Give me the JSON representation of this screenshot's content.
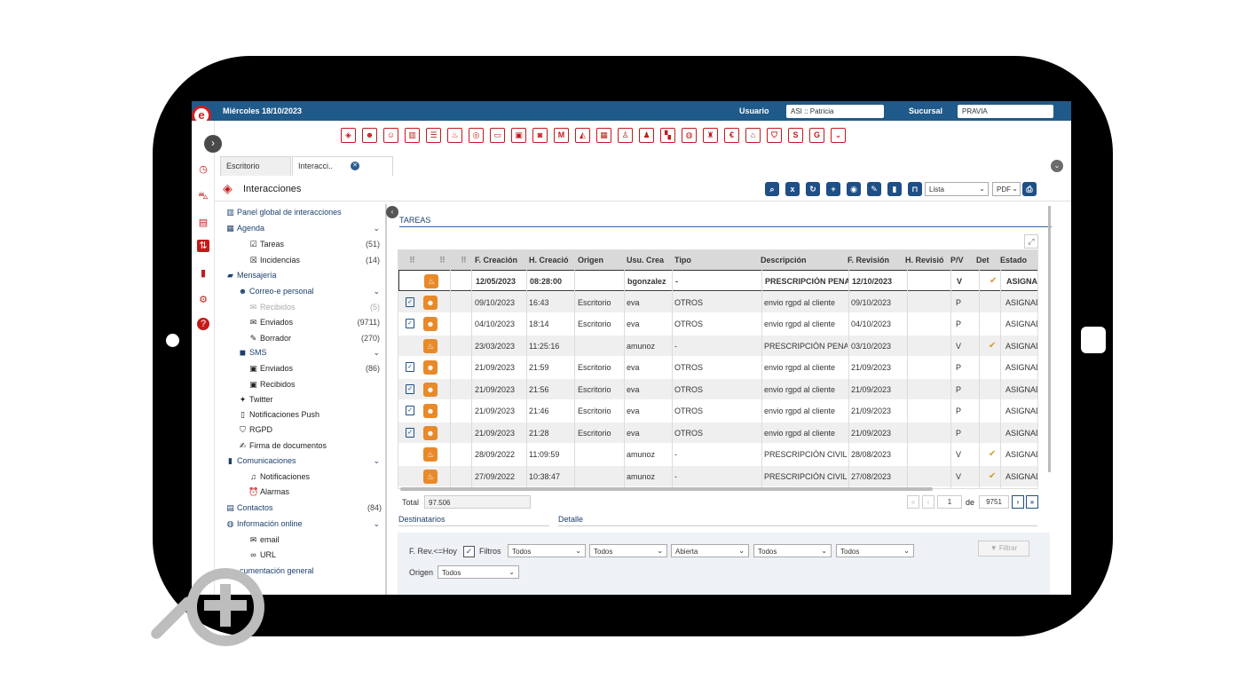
{
  "topbar": {
    "date": "Miércoles 18/10/2023",
    "user_label": "Usuario",
    "user_value": "ASI :: Patricia",
    "branch_label": "Sucursal",
    "branch_value": "PRAVIA"
  },
  "tabs": [
    {
      "label": "Escritorio"
    },
    {
      "label": "Interacci.."
    }
  ],
  "header": {
    "title": "Interacciones",
    "view_select": "Lista",
    "export_select": "PDF"
  },
  "nav": {
    "panel_global": "Panel global de interacciones",
    "agenda": "Agenda",
    "tareas": "Tareas",
    "tareas_count": "(51)",
    "incidencias": "Incidencias",
    "incidencias_count": "(14)",
    "mensajeria": "Mensajería",
    "correo": "Correo-e personal",
    "recibidos": "Recibidos",
    "recibidos_count": "(5)",
    "enviados": "Enviados",
    "enviados_count": "(9711)",
    "borrador": "Borrador",
    "borrador_count": "(270)",
    "sms": "SMS",
    "sms_enviados": "Enviados",
    "sms_enviados_count": "(86)",
    "sms_recibidos": "Recibidos",
    "twitter": "Twitter",
    "push": "Notificaciones Push",
    "rgpd": "RGPD",
    "firma": "Firma de documentos",
    "comunicaciones": "Comunicaciones",
    "notificaciones": "Notificaciones",
    "alarmas": "Alarmas",
    "contactos": "Contactos",
    "contactos_count": "(84)",
    "info_online": "Información online",
    "email": "email",
    "url": "URL",
    "doc_general": "cumentación general"
  },
  "section": {
    "title": "TAREAS"
  },
  "grid": {
    "columns": [
      "F. Creación",
      "H. Creació",
      "Origen",
      "Usu. Crea",
      "Tipo",
      "Descripción",
      "F. Revisión",
      "H. Revisió",
      "P/V",
      "Det",
      "Estado"
    ],
    "rows": [
      {
        "check": false,
        "icon": "fire",
        "f_creacion": "12/05/2023",
        "h_creacion": "08:28:00",
        "origen": "",
        "usuario": "bgonzalez",
        "tipo": "-",
        "descripcion": "PRESCRIPCIÓN PENAL I",
        "f_revision": "12/10/2023",
        "h_revision": "",
        "pv": "V",
        "det": true,
        "estado": "ASIGNAD"
      },
      {
        "check": true,
        "icon": "person",
        "f_creacion": "09/10/2023",
        "h_creacion": "16:43",
        "origen": "Escritorio",
        "usuario": "eva",
        "tipo": "OTROS",
        "descripcion": "envio rgpd al cliente",
        "f_revision": "09/10/2023",
        "h_revision": "",
        "pv": "P",
        "det": false,
        "estado": "ASIGNAD"
      },
      {
        "check": true,
        "icon": "person",
        "f_creacion": "04/10/2023",
        "h_creacion": "18:14",
        "origen": "Escritorio",
        "usuario": "eva",
        "tipo": "OTROS",
        "descripcion": "envio rgpd al cliente",
        "f_revision": "04/10/2023",
        "h_revision": "",
        "pv": "P",
        "det": false,
        "estado": "ASIGNAD"
      },
      {
        "check": false,
        "icon": "fire",
        "f_creacion": "23/03/2023",
        "h_creacion": "11:25:16",
        "origen": "",
        "usuario": "amunoz",
        "tipo": "-",
        "descripcion": "PRESCRIPCIÓN PENAL I",
        "f_revision": "03/10/2023",
        "h_revision": "",
        "pv": "V",
        "det": true,
        "estado": "ASIGNAD"
      },
      {
        "check": true,
        "icon": "person",
        "f_creacion": "21/09/2023",
        "h_creacion": "21:59",
        "origen": "Escritorio",
        "usuario": "eva",
        "tipo": "OTROS",
        "descripcion": "envio rgpd al cliente",
        "f_revision": "21/09/2023",
        "h_revision": "",
        "pv": "P",
        "det": false,
        "estado": "ASIGNAD"
      },
      {
        "check": true,
        "icon": "person",
        "f_creacion": "21/09/2023",
        "h_creacion": "21:56",
        "origen": "Escritorio",
        "usuario": "eva",
        "tipo": "OTROS",
        "descripcion": "envio rgpd al cliente",
        "f_revision": "21/09/2023",
        "h_revision": "",
        "pv": "P",
        "det": false,
        "estado": "ASIGNAD"
      },
      {
        "check": true,
        "icon": "person",
        "f_creacion": "21/09/2023",
        "h_creacion": "21:46",
        "origen": "Escritorio",
        "usuario": "eva",
        "tipo": "OTROS",
        "descripcion": "envio rgpd al cliente",
        "f_revision": "21/09/2023",
        "h_revision": "",
        "pv": "P",
        "det": false,
        "estado": "ASIGNAD"
      },
      {
        "check": true,
        "icon": "person",
        "f_creacion": "21/09/2023",
        "h_creacion": "21:28",
        "origen": "Escritorio",
        "usuario": "eva",
        "tipo": "OTROS",
        "descripcion": "envio rgpd al cliente",
        "f_revision": "21/09/2023",
        "h_revision": "",
        "pv": "P",
        "det": false,
        "estado": "ASIGNAD"
      },
      {
        "check": false,
        "icon": "fire",
        "f_creacion": "28/09/2022",
        "h_creacion": "11:09:59",
        "origen": "",
        "usuario": "amunoz",
        "tipo": "-",
        "descripcion": "PRESCRIPCIÓN CIVIL D",
        "f_revision": "28/08/2023",
        "h_revision": "",
        "pv": "V",
        "det": true,
        "estado": "ASIGNAD"
      },
      {
        "check": false,
        "icon": "fire",
        "f_creacion": "27/09/2022",
        "h_creacion": "10:38:47",
        "origen": "",
        "usuario": "amunoz",
        "tipo": "-",
        "descripcion": "PRESCRIPCIÓN CIVIL D",
        "f_revision": "27/08/2023",
        "h_revision": "",
        "pv": "V",
        "det": true,
        "estado": "ASIGNAD"
      }
    ]
  },
  "footer": {
    "total_label": "Total",
    "total_value": "97.506",
    "page_current": "1",
    "page_of": "de",
    "page_total": "9751",
    "destinatarios": "Destinatarios",
    "detalle": "Detalle"
  },
  "filters": {
    "rev_label": "F. Rev.<=Hoy",
    "filtros_label": "Filtros",
    "f1": "Todos",
    "f2": "Todos",
    "f3": "Abierta",
    "f4": "Todos",
    "f5": "Todos",
    "origen_label": "Origen",
    "origen_value": "Todos",
    "filtrar_button": "Filtrar"
  },
  "colors": {
    "brand_blue": "#1f5a8a",
    "accent_red": "#c41a1a",
    "task_orange": "#e8892a"
  }
}
